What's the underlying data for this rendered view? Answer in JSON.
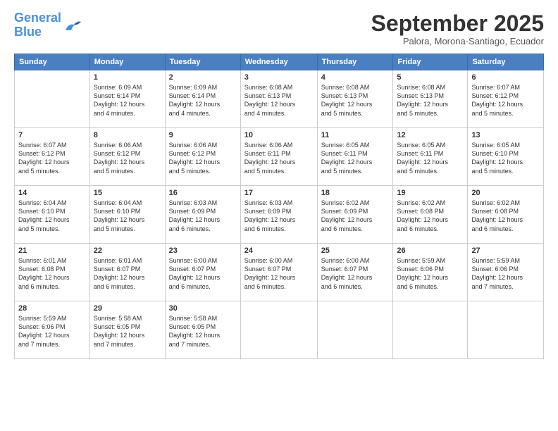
{
  "header": {
    "logo_line1": "General",
    "logo_line2": "Blue",
    "month_title": "September 2025",
    "subtitle": "Palora, Morona-Santiago, Ecuador"
  },
  "days_of_week": [
    "Sunday",
    "Monday",
    "Tuesday",
    "Wednesday",
    "Thursday",
    "Friday",
    "Saturday"
  ],
  "weeks": [
    [
      {
        "day": "",
        "info": ""
      },
      {
        "day": "1",
        "info": "Sunrise: 6:09 AM\nSunset: 6:14 PM\nDaylight: 12 hours\nand 4 minutes."
      },
      {
        "day": "2",
        "info": "Sunrise: 6:09 AM\nSunset: 6:14 PM\nDaylight: 12 hours\nand 4 minutes."
      },
      {
        "day": "3",
        "info": "Sunrise: 6:08 AM\nSunset: 6:13 PM\nDaylight: 12 hours\nand 4 minutes."
      },
      {
        "day": "4",
        "info": "Sunrise: 6:08 AM\nSunset: 6:13 PM\nDaylight: 12 hours\nand 5 minutes."
      },
      {
        "day": "5",
        "info": "Sunrise: 6:08 AM\nSunset: 6:13 PM\nDaylight: 12 hours\nand 5 minutes."
      },
      {
        "day": "6",
        "info": "Sunrise: 6:07 AM\nSunset: 6:12 PM\nDaylight: 12 hours\nand 5 minutes."
      }
    ],
    [
      {
        "day": "7",
        "info": "Sunrise: 6:07 AM\nSunset: 6:12 PM\nDaylight: 12 hours\nand 5 minutes."
      },
      {
        "day": "8",
        "info": "Sunrise: 6:06 AM\nSunset: 6:12 PM\nDaylight: 12 hours\nand 5 minutes."
      },
      {
        "day": "9",
        "info": "Sunrise: 6:06 AM\nSunset: 6:12 PM\nDaylight: 12 hours\nand 5 minutes."
      },
      {
        "day": "10",
        "info": "Sunrise: 6:06 AM\nSunset: 6:11 PM\nDaylight: 12 hours\nand 5 minutes."
      },
      {
        "day": "11",
        "info": "Sunrise: 6:05 AM\nSunset: 6:11 PM\nDaylight: 12 hours\nand 5 minutes."
      },
      {
        "day": "12",
        "info": "Sunrise: 6:05 AM\nSunset: 6:11 PM\nDaylight: 12 hours\nand 5 minutes."
      },
      {
        "day": "13",
        "info": "Sunrise: 6:05 AM\nSunset: 6:10 PM\nDaylight: 12 hours\nand 5 minutes."
      }
    ],
    [
      {
        "day": "14",
        "info": "Sunrise: 6:04 AM\nSunset: 6:10 PM\nDaylight: 12 hours\nand 5 minutes."
      },
      {
        "day": "15",
        "info": "Sunrise: 6:04 AM\nSunset: 6:10 PM\nDaylight: 12 hours\nand 5 minutes."
      },
      {
        "day": "16",
        "info": "Sunrise: 6:03 AM\nSunset: 6:09 PM\nDaylight: 12 hours\nand 6 minutes."
      },
      {
        "day": "17",
        "info": "Sunrise: 6:03 AM\nSunset: 6:09 PM\nDaylight: 12 hours\nand 6 minutes."
      },
      {
        "day": "18",
        "info": "Sunrise: 6:02 AM\nSunset: 6:09 PM\nDaylight: 12 hours\nand 6 minutes."
      },
      {
        "day": "19",
        "info": "Sunrise: 6:02 AM\nSunset: 6:08 PM\nDaylight: 12 hours\nand 6 minutes."
      },
      {
        "day": "20",
        "info": "Sunrise: 6:02 AM\nSunset: 6:08 PM\nDaylight: 12 hours\nand 6 minutes."
      }
    ],
    [
      {
        "day": "21",
        "info": "Sunrise: 6:01 AM\nSunset: 6:08 PM\nDaylight: 12 hours\nand 6 minutes."
      },
      {
        "day": "22",
        "info": "Sunrise: 6:01 AM\nSunset: 6:07 PM\nDaylight: 12 hours\nand 6 minutes."
      },
      {
        "day": "23",
        "info": "Sunrise: 6:00 AM\nSunset: 6:07 PM\nDaylight: 12 hours\nand 6 minutes."
      },
      {
        "day": "24",
        "info": "Sunrise: 6:00 AM\nSunset: 6:07 PM\nDaylight: 12 hours\nand 6 minutes."
      },
      {
        "day": "25",
        "info": "Sunrise: 6:00 AM\nSunset: 6:07 PM\nDaylight: 12 hours\nand 6 minutes."
      },
      {
        "day": "26",
        "info": "Sunrise: 5:59 AM\nSunset: 6:06 PM\nDaylight: 12 hours\nand 6 minutes."
      },
      {
        "day": "27",
        "info": "Sunrise: 5:59 AM\nSunset: 6:06 PM\nDaylight: 12 hours\nand 7 minutes."
      }
    ],
    [
      {
        "day": "28",
        "info": "Sunrise: 5:59 AM\nSunset: 6:06 PM\nDaylight: 12 hours\nand 7 minutes."
      },
      {
        "day": "29",
        "info": "Sunrise: 5:58 AM\nSunset: 6:05 PM\nDaylight: 12 hours\nand 7 minutes."
      },
      {
        "day": "30",
        "info": "Sunrise: 5:58 AM\nSunset: 6:05 PM\nDaylight: 12 hours\nand 7 minutes."
      },
      {
        "day": "",
        "info": ""
      },
      {
        "day": "",
        "info": ""
      },
      {
        "day": "",
        "info": ""
      },
      {
        "day": "",
        "info": ""
      }
    ]
  ]
}
